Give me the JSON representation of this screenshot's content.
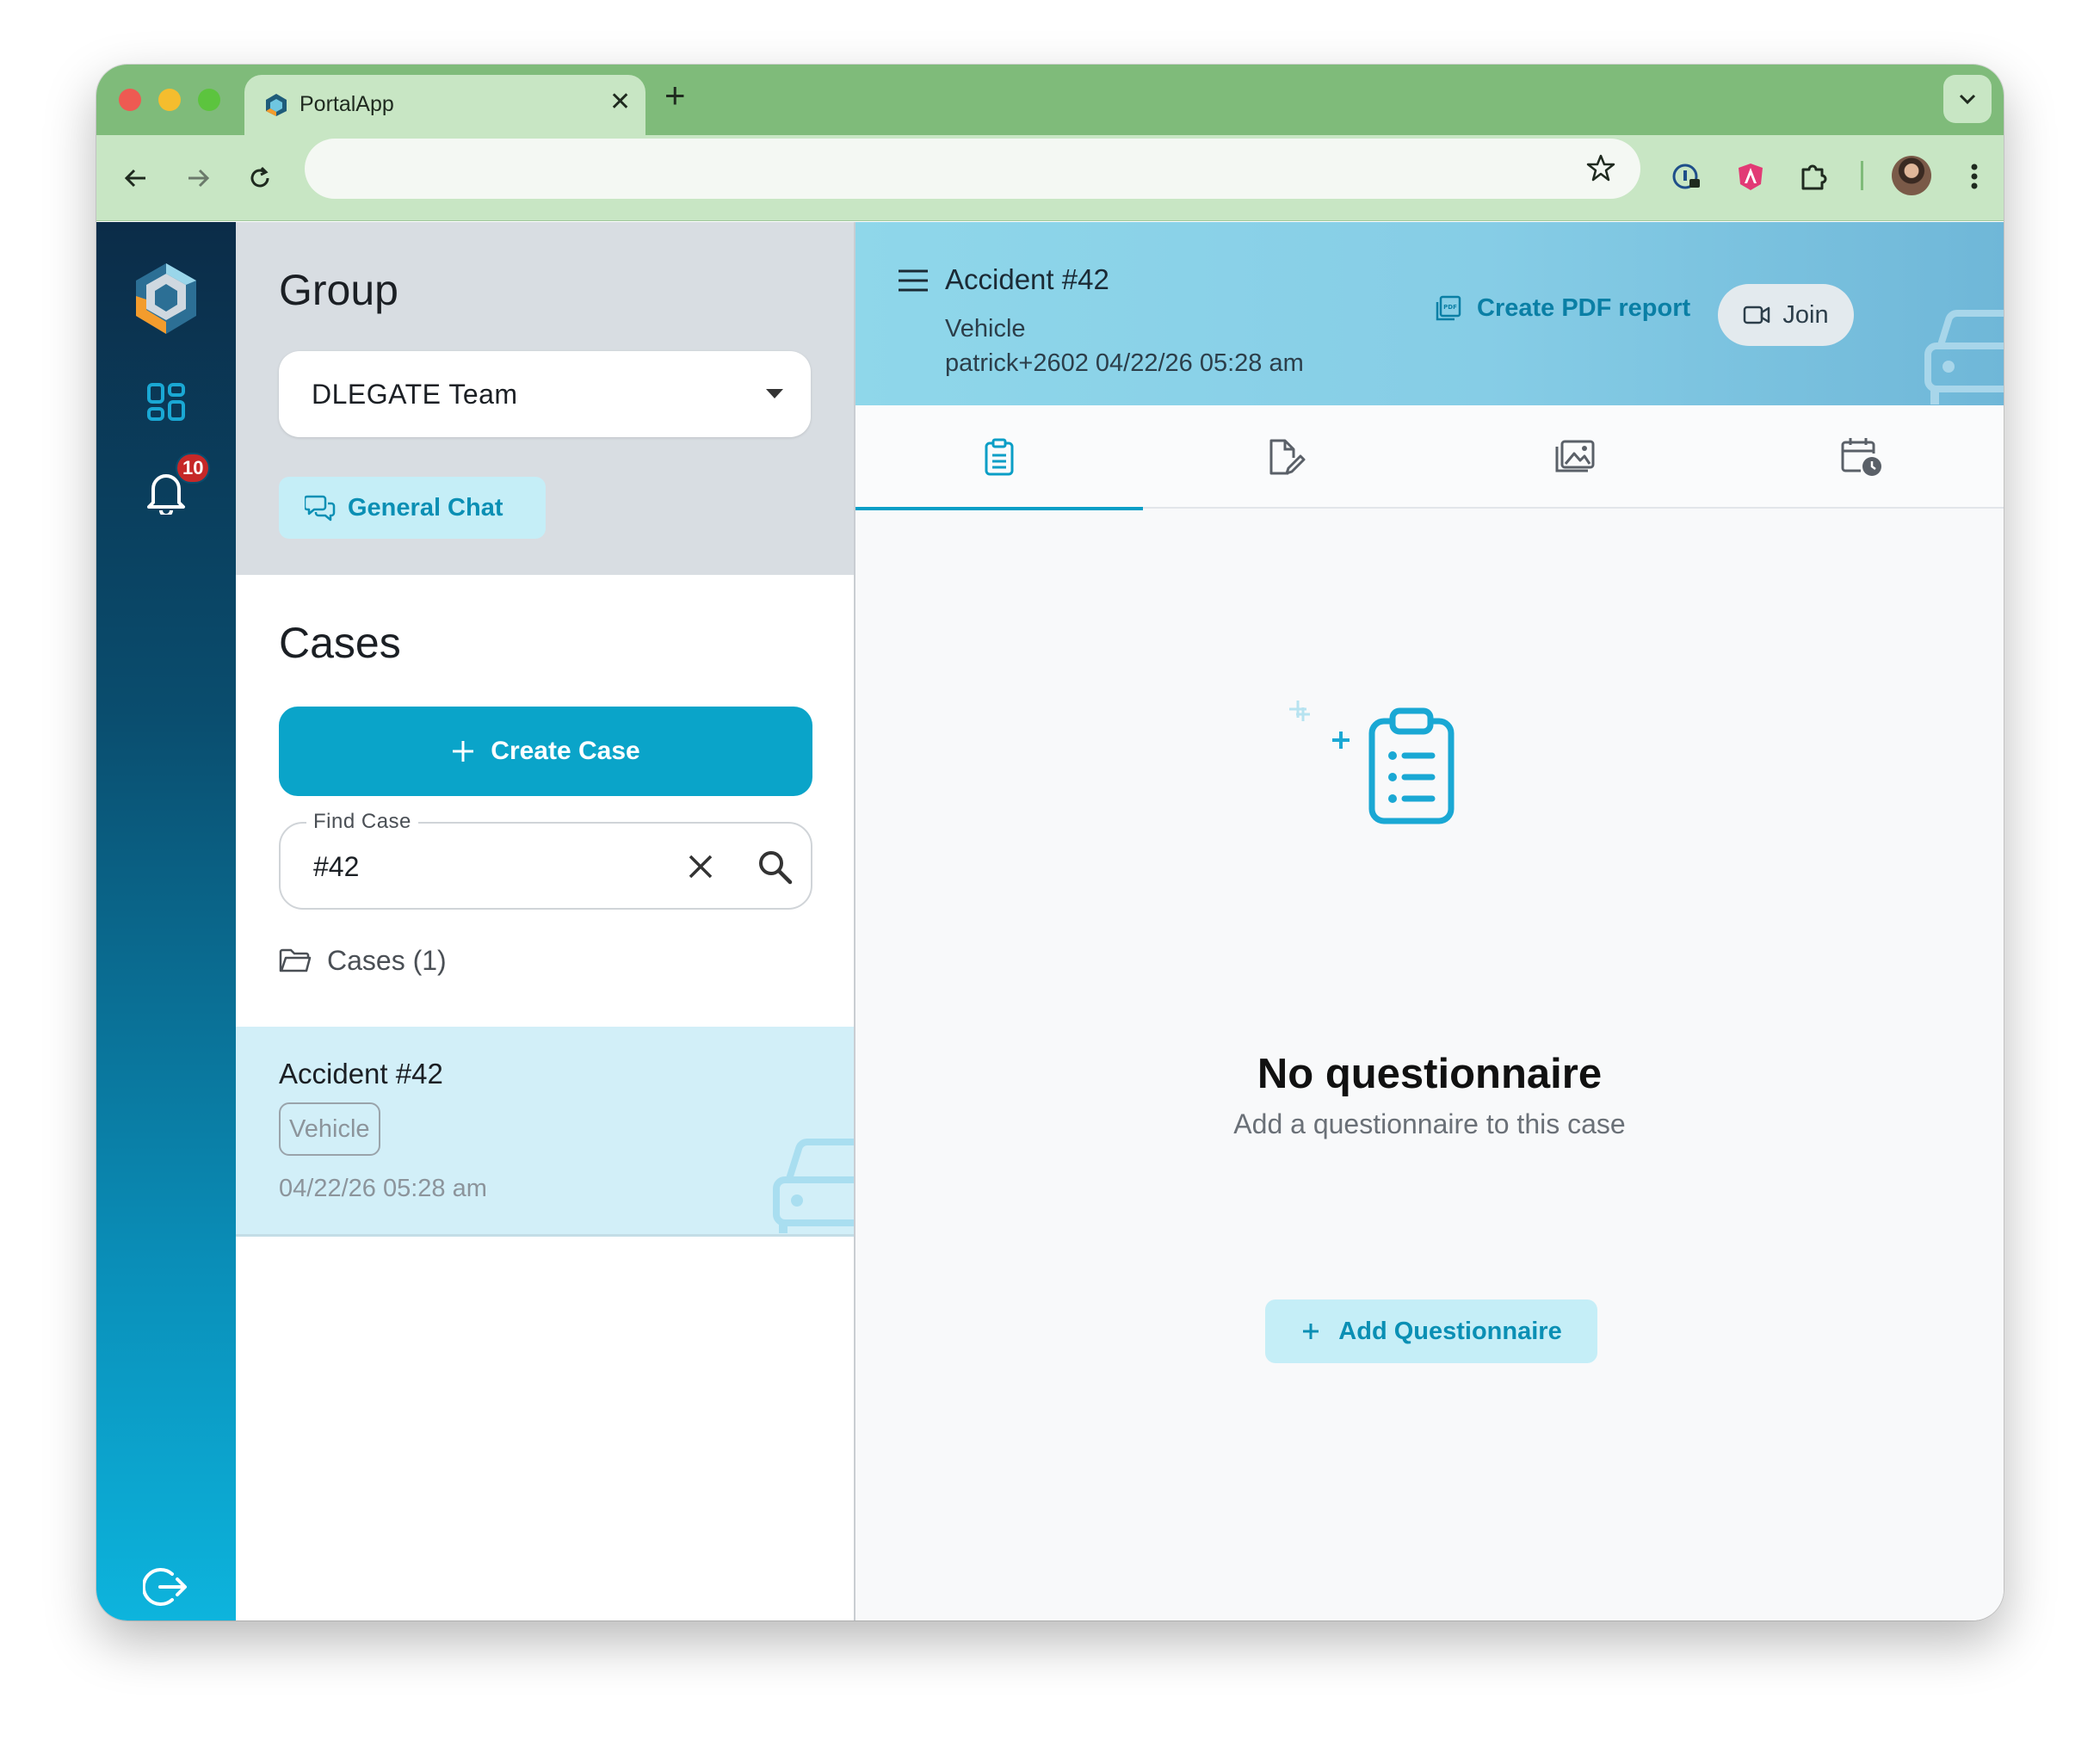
{
  "browser": {
    "tab_title": "PortalApp",
    "url": ""
  },
  "rail": {
    "notification_count": "10"
  },
  "group": {
    "title": "Group",
    "selected_team": "DLEGATE Team",
    "chat_button": "General Chat"
  },
  "cases": {
    "title": "Cases",
    "create_button": "Create Case",
    "find_label": "Find Case",
    "find_value": "#42",
    "folder_label": "Cases (1)",
    "items": [
      {
        "title": "Accident #42",
        "tag": "Vehicle",
        "date": "04/22/26 05:28 am"
      }
    ]
  },
  "case_detail": {
    "title": "Accident #42",
    "category": "Vehicle",
    "meta": "patrick+2602 04/22/26 05:28 am",
    "pdf_button": "Create PDF report",
    "join_button": "Join"
  },
  "tabs": [
    {
      "icon": "clipboard-list-icon",
      "active": true
    },
    {
      "icon": "document-edit-icon",
      "active": false
    },
    {
      "icon": "gallery-icon",
      "active": false
    },
    {
      "icon": "calendar-clock-icon",
      "active": false
    }
  ],
  "empty_state": {
    "title": "No questionnaire",
    "subtitle": "Add a questionnaire to this case",
    "button": "Add Questionnaire"
  },
  "colors": {
    "accent": "#0aa4c9",
    "accent_light": "#c5eef7",
    "header_bg": "#8fd7ea",
    "browser_frame": "#7fbb7a",
    "badge": "#c62828"
  }
}
